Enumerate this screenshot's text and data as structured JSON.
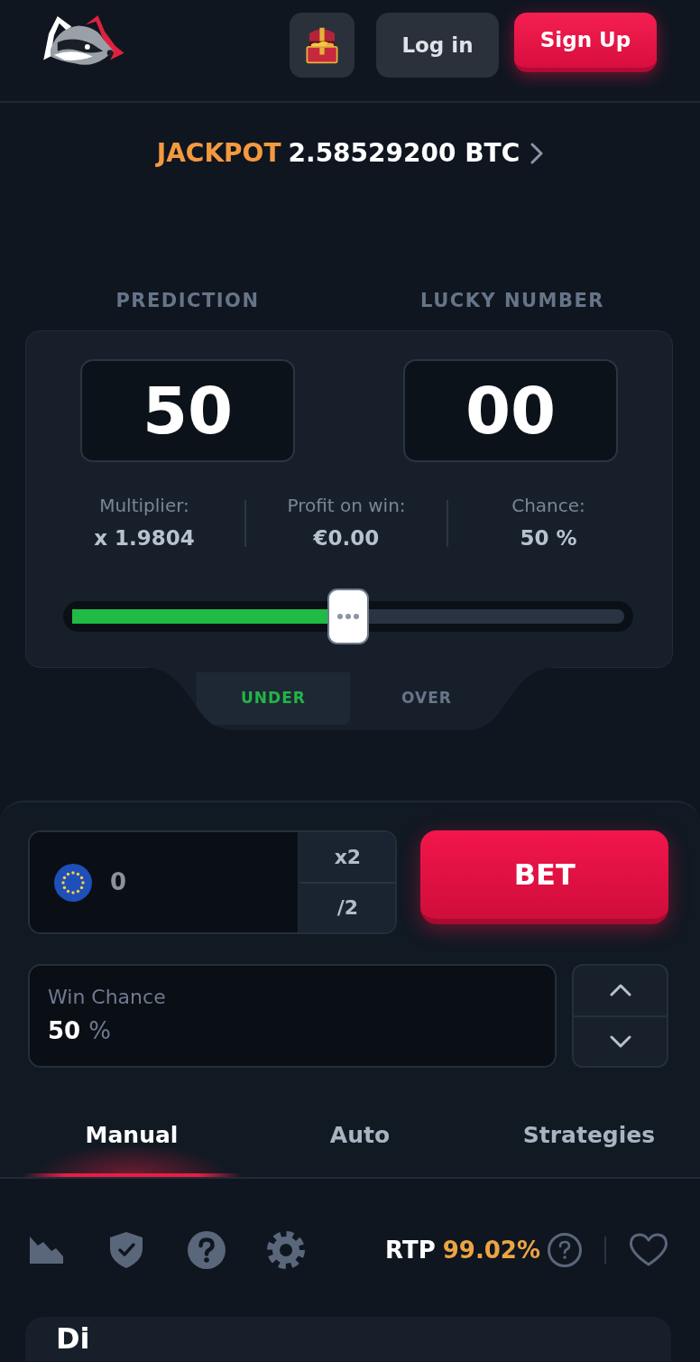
{
  "header": {
    "login_button": "Log in",
    "signup_button": "Sign Up"
  },
  "jackpot": {
    "label": "JACKPOT",
    "amount": "2.58529200 BTC"
  },
  "game": {
    "displays": [
      {
        "heading": "PREDICTION",
        "value": "50"
      },
      {
        "heading": "LUCKY NUMBER",
        "value": "00"
      }
    ],
    "stats": [
      {
        "label": "Multiplier:",
        "value": "x 1.9804"
      },
      {
        "label": "Profit on win:",
        "value": "€0.00"
      },
      {
        "label": "Chance:",
        "value": "50 %"
      }
    ],
    "slider": {
      "level": 0.5
    },
    "direction_tabs": [
      {
        "label": "UNDER",
        "selected": true
      },
      {
        "label": "OVER",
        "selected": false
      }
    ]
  },
  "bet": {
    "amount": "0",
    "amount_buttons": [
      "x2",
      "/2"
    ],
    "bet_button": "BET",
    "win_chance": {
      "label": "Win Chance",
      "value": "50",
      "unit": "%"
    }
  },
  "mode_tabs": [
    {
      "label": "Manual",
      "selected": true
    },
    {
      "label": "Auto",
      "selected": false
    },
    {
      "label": "Strategies",
      "selected": false
    }
  ],
  "toolbar": {
    "rtp_label": "RTP",
    "rtp_value": "99.02%"
  },
  "bottom_panel": {
    "title": "Di"
  }
}
